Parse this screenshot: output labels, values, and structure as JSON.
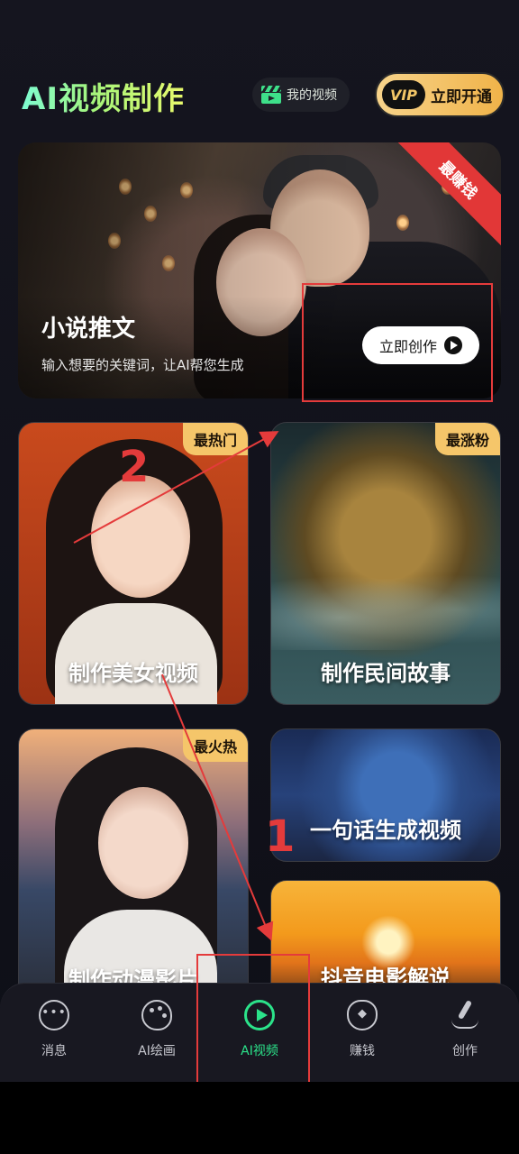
{
  "header": {
    "title": "AI视频制作",
    "my_video_label": "我的视频",
    "vip_badge": "VIP",
    "vip_label": "立即开通"
  },
  "hero": {
    "ribbon": "最赚钱",
    "title": "小说推文",
    "subtitle": "输入想要的关键词，让AI帮您生成",
    "cta_label": "立即创作"
  },
  "cards": {
    "beauty": {
      "tag": "最热门",
      "label": "制作美女视频"
    },
    "folk": {
      "tag": "最涨粉",
      "label": "制作民间故事"
    },
    "anime": {
      "tag": "最火热",
      "label": "制作动漫影片"
    },
    "sentence": {
      "label": "一句话生成视频"
    },
    "movie": {
      "label": "抖音电影解说"
    }
  },
  "annotations": {
    "number_1": "1",
    "number_2": "2",
    "color": "#e43b3b"
  },
  "nav": {
    "items": [
      {
        "label": "消息",
        "icon": "chat-bubble-icon"
      },
      {
        "label": "AI绘画",
        "icon": "palette-icon"
      },
      {
        "label": "AI视频",
        "icon": "play-circle-icon",
        "active": true
      },
      {
        "label": "赚钱",
        "icon": "money-bag-icon"
      },
      {
        "label": "创作",
        "icon": "brush-icon"
      }
    ]
  },
  "colors": {
    "accent": "#2be38a",
    "vip_gold": "#f0b349",
    "tag_gold": "#f5c66a",
    "ribbon_red": "#e23737"
  }
}
